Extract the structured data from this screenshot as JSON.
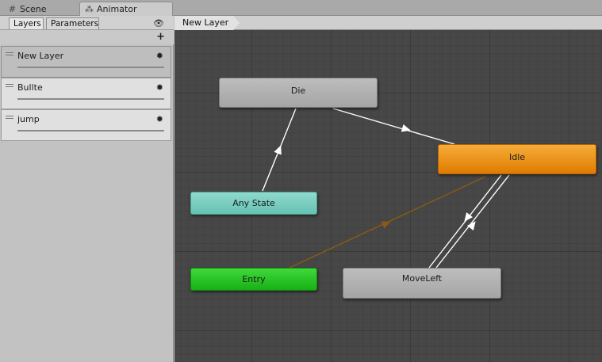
{
  "tabs": [
    {
      "label": "Scene",
      "icon": "grid-icon"
    },
    {
      "label": "Animator",
      "icon": "animator-icon",
      "active": true
    }
  ],
  "left_panel": {
    "subtabs": [
      "Layers",
      "Parameters"
    ],
    "layers": [
      {
        "name": "New Layer",
        "selected": true
      },
      {
        "name": "Bullte"
      },
      {
        "name": "jump"
      }
    ]
  },
  "breadcrumb": "New Layer",
  "states": {
    "die": "Die",
    "idle": "Idle",
    "any_state": "Any State",
    "entry": "Entry",
    "move_left": "MoveLeft"
  },
  "colors": {
    "default_state": "#f39a1a",
    "any_state": "#7dd0c4",
    "entry": "#2ad027",
    "state": "#b3b3b3",
    "graph_bg": "#474747",
    "entry_transition": "#8a5a12"
  }
}
